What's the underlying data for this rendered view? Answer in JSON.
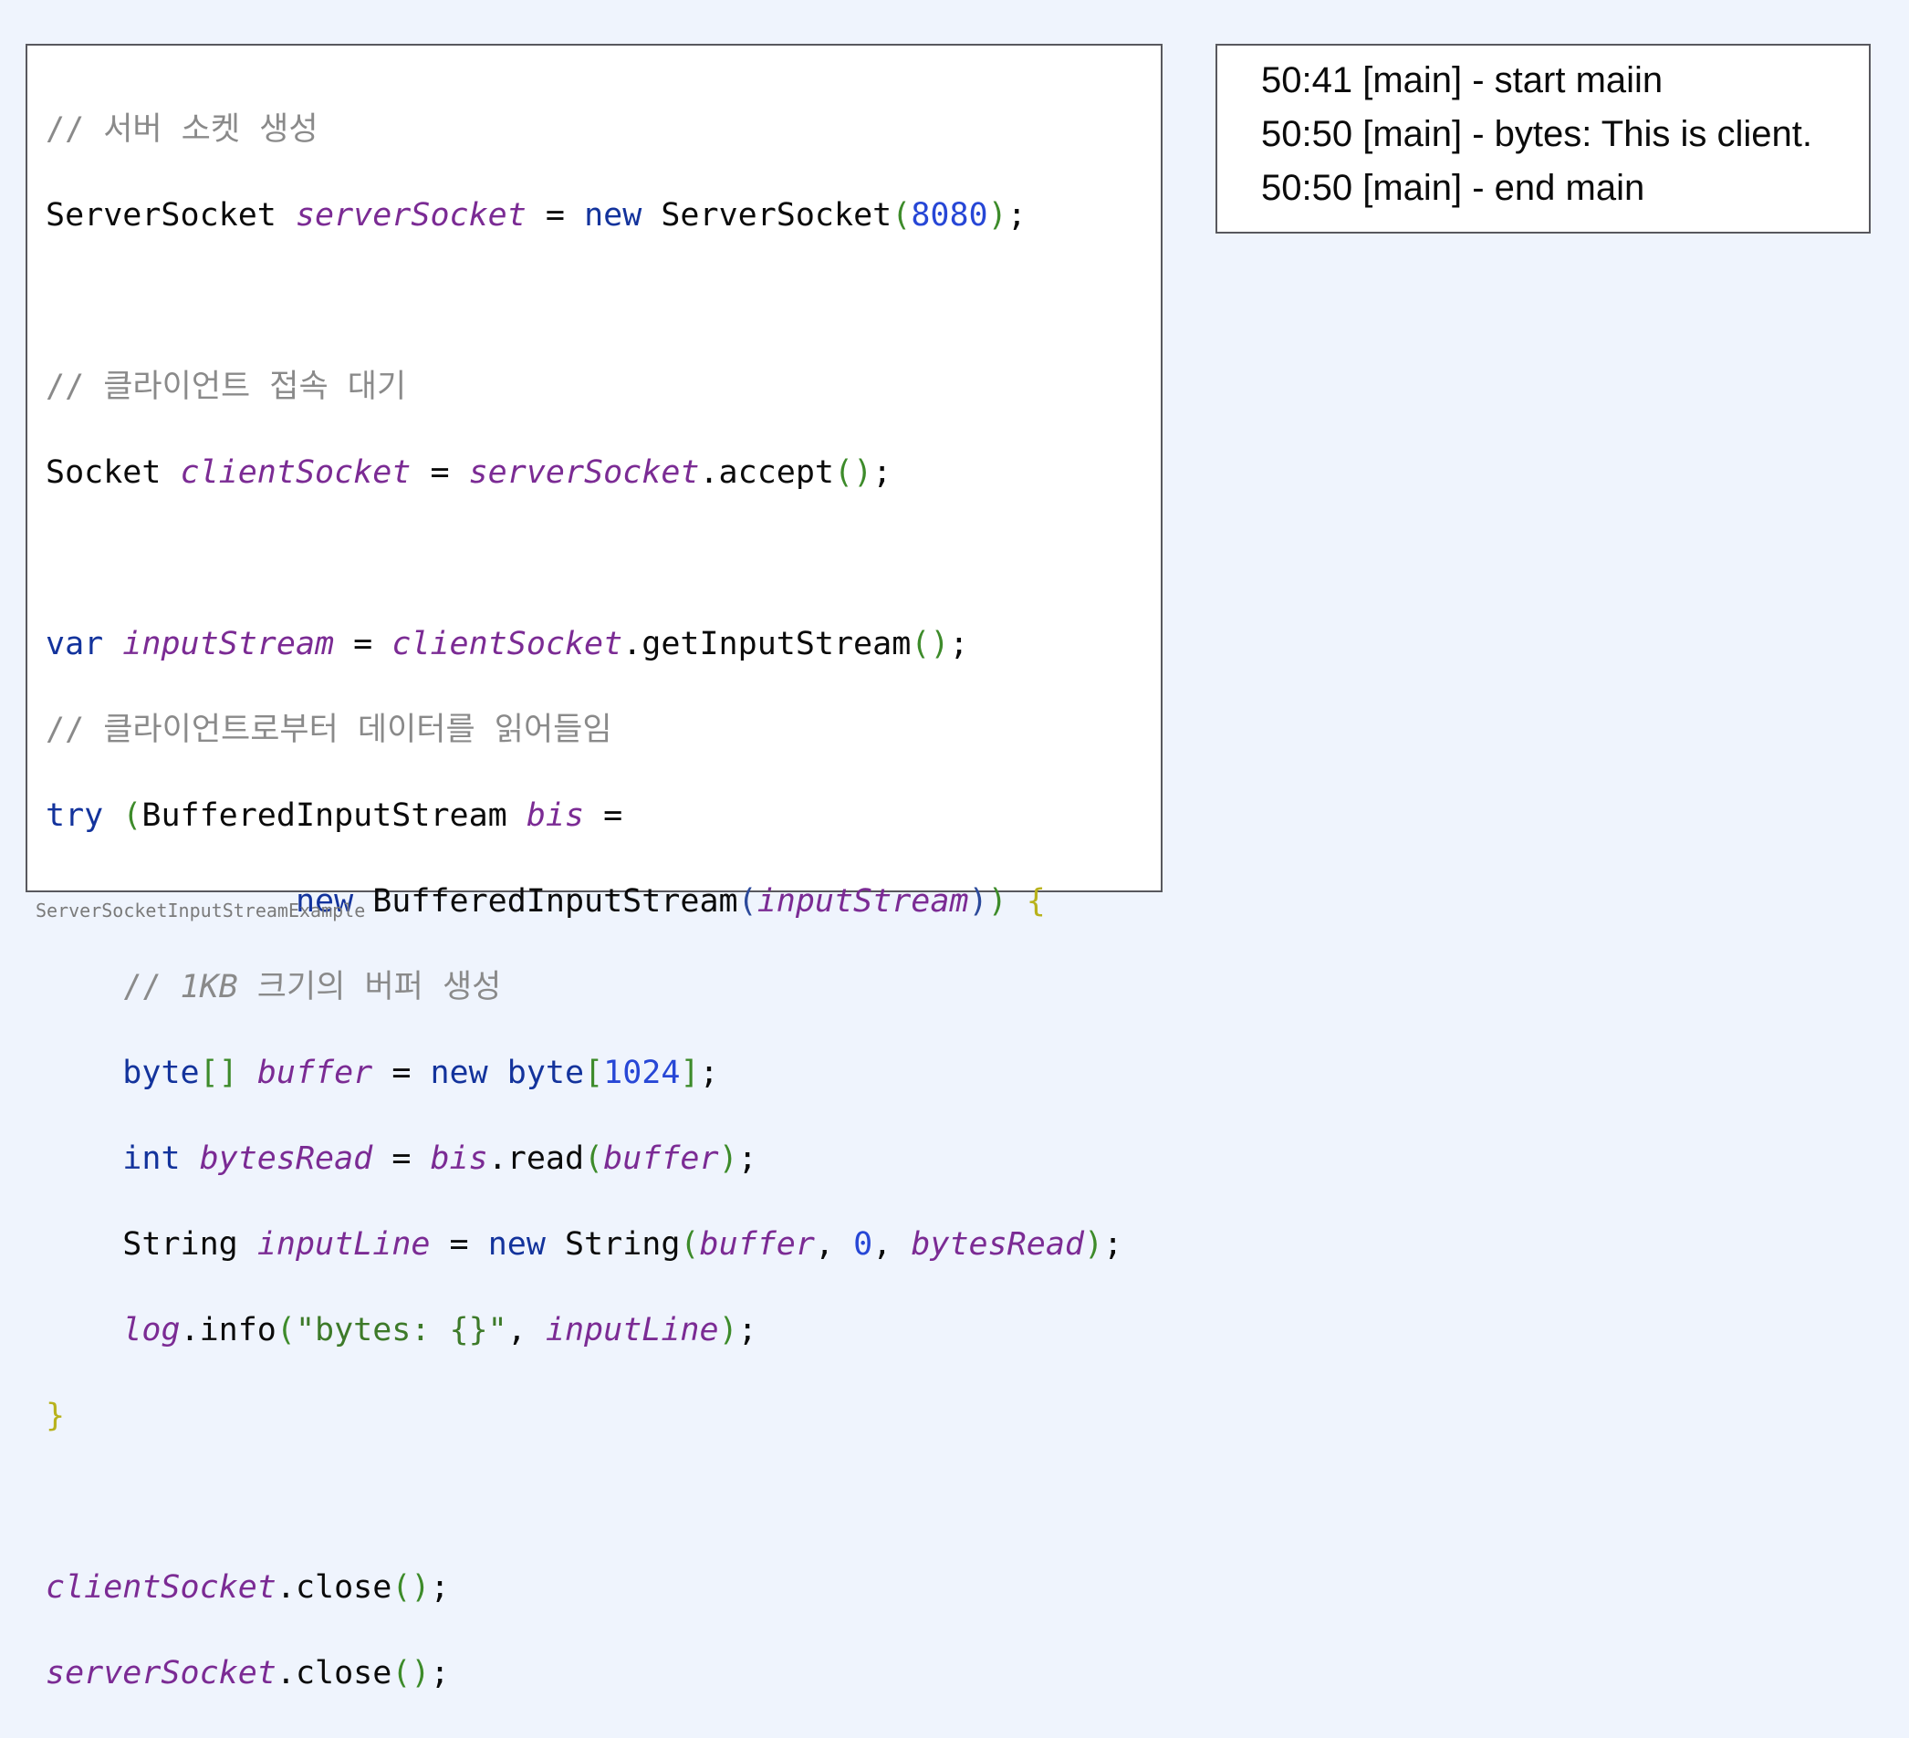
{
  "code": {
    "comment_server": "// 서버 소켓 생성",
    "t_ServerSocket1": "ServerSocket",
    "v_serverSocket1": "serverSocket",
    "op_eq": "=",
    "kw_new": "new",
    "t_ServerSocket2": "ServerSocket",
    "n_8080": "8080",
    "comment_wait": "// 클라이언트 접속 대기",
    "t_Socket": "Socket",
    "v_clientSocket1": "clientSocket",
    "v_serverSocket2": "serverSocket",
    "m_accept": ".accept",
    "kw_var": "var",
    "v_inputStream1": "inputStream",
    "v_clientSocket2": "clientSocket",
    "m_getInputStream": ".getInputStream",
    "comment_read": "// 클라이언트로부터 데이터를 읽어들임",
    "kw_try": "try",
    "t_BIS1": "BufferedInputStream",
    "v_bis1": "bis",
    "kw_new2": "new",
    "t_BIS2": "BufferedInputStream",
    "v_inputStream2": "inputStream",
    "comment_buffer_slash": "// ",
    "comment_buffer_1kb": "1KB",
    "comment_buffer_rest": " 크기의 버퍼 생성",
    "kw_byte1": "byte",
    "v_buffer1": "buffer",
    "kw_new3": "new",
    "kw_byte2": "byte",
    "n_1024": "1024",
    "kw_int": "int",
    "v_bytesRead1": "bytesRead",
    "v_bis2": "bis",
    "m_read": ".read",
    "v_buffer2": "buffer",
    "t_String1": "String",
    "v_inputLine1": "inputLine",
    "kw_new4": "new",
    "t_String2": "String",
    "v_buffer3": "buffer",
    "n_0": "0",
    "v_bytesRead2": "bytesRead",
    "v_log": "log",
    "m_info": ".info",
    "s_bytes": "\"bytes: {}\"",
    "v_inputLine2": "inputLine",
    "v_clientSocket3": "clientSocket",
    "m_close1": ".close",
    "v_serverSocket3": "serverSocket",
    "m_close2": ".close"
  },
  "caption": "ServerSocketInputStreamExample",
  "output": {
    "lines": [
      "50:41 [main] - start maiin",
      "50:50 [main] - bytes: This is client.",
      "50:50 [main] - end main"
    ]
  },
  "colors": {
    "background": "#eff4fd",
    "comment": "#8a8a8a",
    "keyword": "#13339c",
    "variable": "#7b2b94",
    "number": "#2747d6",
    "string": "#3d7a29"
  }
}
